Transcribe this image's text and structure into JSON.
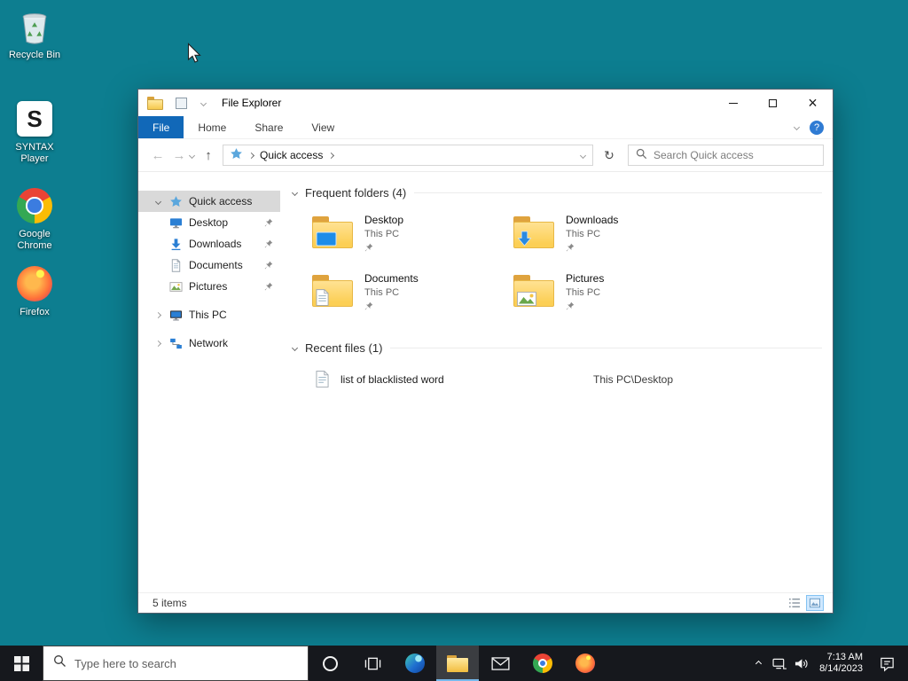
{
  "desktop": {
    "icons": [
      {
        "label": "Recycle Bin"
      },
      {
        "label": "SYNTAX Player"
      },
      {
        "label": "Google Chrome"
      },
      {
        "label": "Firefox"
      }
    ],
    "syntax_glyph": "S"
  },
  "explorer": {
    "window_title": "File Explorer",
    "tabs": [
      "File",
      "Home",
      "Share",
      "View"
    ],
    "breadcrumb": "Quick access",
    "search_placeholder": "Search Quick access",
    "sidebar": [
      {
        "label": "Quick access"
      },
      {
        "label": "Desktop"
      },
      {
        "label": "Downloads"
      },
      {
        "label": "Documents"
      },
      {
        "label": "Pictures"
      },
      {
        "label": "This PC"
      },
      {
        "label": "Network"
      }
    ],
    "frequent": {
      "header": "Frequent folders (4)",
      "items": [
        {
          "name": "Desktop",
          "location": "This PC"
        },
        {
          "name": "Downloads",
          "location": "This PC"
        },
        {
          "name": "Documents",
          "location": "This PC"
        },
        {
          "name": "Pictures",
          "location": "This PC"
        }
      ]
    },
    "recent": {
      "header": "Recent files (1)",
      "items": [
        {
          "name": "list of blacklisted word",
          "location": "This PC\\Desktop"
        }
      ]
    },
    "status": "5 items"
  },
  "taskbar": {
    "search_placeholder": "Type here to search",
    "time": "7:13 AM",
    "date": "8/14/2023"
  }
}
